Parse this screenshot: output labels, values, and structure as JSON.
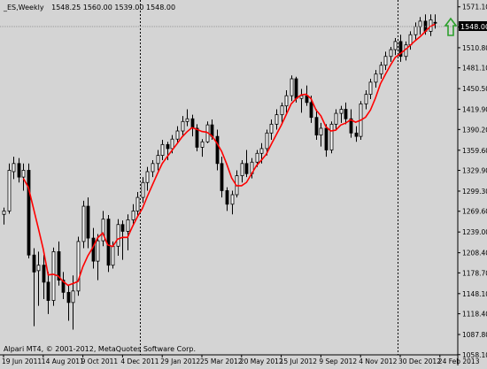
{
  "header": {
    "symbol": "_ES,Weekly",
    "ohlc": "1548.25 1560.00 1539.00 1548.00"
  },
  "watermark": "Alpari MT4, © 2001-2012, MetaQuotes Software Corp.",
  "price_tag": "1548.00",
  "colors": {
    "background": "#d4d4d4",
    "candle_up_fill": "#ffffff",
    "candle_down_fill": "#000000",
    "ma_line": "#ff0000",
    "arrow": "#2ca02c",
    "separator": "#000000",
    "price_tag_bg": "#000000",
    "price_tag_text": "#ffffff"
  },
  "chart_data": {
    "type": "candlestick",
    "timeframe": "Weekly",
    "ylim": [
      1057.8,
      1581.2
    ],
    "y_ticks": [
      "1571.10",
      "1541.40",
      "1510.80",
      "1481.10",
      "1450.50",
      "1419.90",
      "1390.20",
      "1359.60",
      "1329.90",
      "1299.30",
      "1269.60",
      "1239.00",
      "1208.40",
      "1178.70",
      "1148.10",
      "1118.40",
      "1087.80",
      "1058.10"
    ],
    "y_tick_values": [
      1571.1,
      1541.4,
      1510.8,
      1481.1,
      1450.5,
      1419.9,
      1390.2,
      1359.6,
      1329.9,
      1299.3,
      1269.6,
      1239.0,
      1208.4,
      1178.7,
      1148.1,
      1118.4,
      1087.8,
      1058.1
    ],
    "x_ticks": [
      "19 Jun 2011",
      "14 Aug 2011",
      "9 Oct 2011",
      "4 Dec 2011",
      "29 Jan 2012",
      "25 Mar 2012",
      "20 May 2012",
      "15 Jul 2012",
      "9 Sep 2012",
      "4 Nov 2012",
      "30 Dec 2012",
      "24 Feb 2013"
    ],
    "x_tick_bar_index": [
      0,
      8,
      16,
      24,
      32,
      40,
      48,
      56,
      64,
      72,
      80,
      88
    ],
    "separators_after_bar": [
      27,
      79
    ],
    "ma_period": 5,
    "ma_label": "",
    "candles": [
      [
        1265,
        1275,
        1250,
        1270
      ],
      [
        1270,
        1340,
        1266,
        1330
      ],
      [
        1328,
        1350,
        1317,
        1340
      ],
      [
        1340,
        1348,
        1312,
        1320
      ],
      [
        1320,
        1340,
        1300,
        1330
      ],
      [
        1330,
        1340,
        1200,
        1205
      ],
      [
        1205,
        1215,
        1100,
        1180
      ],
      [
        1182,
        1210,
        1130,
        1190
      ],
      [
        1190,
        1205,
        1140,
        1165
      ],
      [
        1165,
        1180,
        1118,
        1138
      ],
      [
        1138,
        1216,
        1130,
        1210
      ],
      [
        1210,
        1225,
        1160,
        1168
      ],
      [
        1168,
        1180,
        1140,
        1150
      ],
      [
        1150,
        1160,
        1108,
        1135
      ],
      [
        1135,
        1175,
        1095,
        1152
      ],
      [
        1152,
        1232,
        1145,
        1225
      ],
      [
        1225,
        1285,
        1215,
        1277
      ],
      [
        1277,
        1290,
        1215,
        1230
      ],
      [
        1230,
        1245,
        1185,
        1196
      ],
      [
        1196,
        1236,
        1168,
        1226
      ],
      [
        1226,
        1270,
        1218,
        1258
      ],
      [
        1258,
        1264,
        1180,
        1190
      ],
      [
        1190,
        1225,
        1185,
        1218
      ],
      [
        1218,
        1258,
        1204,
        1250
      ],
      [
        1250,
        1256,
        1198,
        1240
      ],
      [
        1240,
        1265,
        1212,
        1257
      ],
      [
        1257,
        1280,
        1248,
        1270
      ],
      [
        1270,
        1298,
        1262,
        1290
      ],
      [
        1290,
        1320,
        1282,
        1312
      ],
      [
        1312,
        1335,
        1300,
        1328
      ],
      [
        1328,
        1345,
        1320,
        1340
      ],
      [
        1340,
        1360,
        1330,
        1352
      ],
      [
        1352,
        1375,
        1345,
        1368
      ],
      [
        1368,
        1372,
        1345,
        1362
      ],
      [
        1362,
        1382,
        1355,
        1376
      ],
      [
        1376,
        1395,
        1370,
        1388
      ],
      [
        1388,
        1410,
        1380,
        1402
      ],
      [
        1402,
        1420,
        1395,
        1406
      ],
      [
        1406,
        1412,
        1380,
        1392
      ],
      [
        1392,
        1398,
        1358,
        1364
      ],
      [
        1364,
        1376,
        1350,
        1372
      ],
      [
        1372,
        1402,
        1370,
        1397
      ],
      [
        1397,
        1405,
        1375,
        1380
      ],
      [
        1380,
        1390,
        1330,
        1340
      ],
      [
        1340,
        1350,
        1290,
        1300
      ],
      [
        1300,
        1305,
        1270,
        1280
      ],
      [
        1280,
        1300,
        1265,
        1294
      ],
      [
        1294,
        1330,
        1290,
        1322
      ],
      [
        1322,
        1345,
        1312,
        1340
      ],
      [
        1340,
        1360,
        1320,
        1325
      ],
      [
        1325,
        1348,
        1318,
        1342
      ],
      [
        1342,
        1360,
        1335,
        1355
      ],
      [
        1355,
        1370,
        1340,
        1362
      ],
      [
        1362,
        1390,
        1352,
        1385
      ],
      [
        1385,
        1405,
        1375,
        1398
      ],
      [
        1398,
        1420,
        1390,
        1412
      ],
      [
        1412,
        1430,
        1400,
        1425
      ],
      [
        1425,
        1448,
        1415,
        1440
      ],
      [
        1440,
        1470,
        1432,
        1465
      ],
      [
        1465,
        1468,
        1430,
        1436
      ],
      [
        1436,
        1450,
        1415,
        1440
      ],
      [
        1440,
        1455,
        1425,
        1430
      ],
      [
        1430,
        1440,
        1400,
        1408
      ],
      [
        1408,
        1420,
        1375,
        1382
      ],
      [
        1382,
        1400,
        1365,
        1392
      ],
      [
        1392,
        1398,
        1350,
        1360
      ],
      [
        1360,
        1402,
        1355,
        1398
      ],
      [
        1398,
        1420,
        1390,
        1414
      ],
      [
        1414,
        1425,
        1400,
        1420
      ],
      [
        1420,
        1430,
        1398,
        1406
      ],
      [
        1406,
        1420,
        1378,
        1385
      ],
      [
        1385,
        1395,
        1372,
        1380
      ],
      [
        1380,
        1432,
        1375,
        1428
      ],
      [
        1428,
        1448,
        1420,
        1442
      ],
      [
        1442,
        1465,
        1435,
        1460
      ],
      [
        1460,
        1478,
        1452,
        1472
      ],
      [
        1472,
        1490,
        1465,
        1485
      ],
      [
        1485,
        1505,
        1478,
        1498
      ],
      [
        1498,
        1512,
        1490,
        1508
      ],
      [
        1508,
        1525,
        1500,
        1520
      ],
      [
        1520,
        1530,
        1490,
        1498
      ],
      [
        1498,
        1520,
        1492,
        1515
      ],
      [
        1515,
        1535,
        1508,
        1530
      ],
      [
        1530,
        1548,
        1522,
        1542
      ],
      [
        1542,
        1556,
        1530,
        1550
      ],
      [
        1550,
        1560,
        1530,
        1535
      ],
      [
        1535,
        1560,
        1528,
        1552
      ],
      [
        1548.25,
        1560,
        1539,
        1548
      ]
    ]
  }
}
